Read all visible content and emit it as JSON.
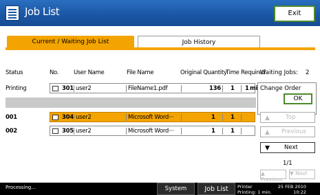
{
  "title": "Job List",
  "exit_label": "Exit",
  "tabs": [
    {
      "label": "Current / Waiting Job List"
    },
    {
      "label": "Job History"
    }
  ],
  "headers": {
    "status": "Status",
    "no": "No.",
    "user": "User Name",
    "file": "File Name",
    "qty": "Original Quantity",
    "time": "Time Required"
  },
  "rows": [
    {
      "status": "Printing",
      "no": "301",
      "user": "user2",
      "file": "FileName1.pdf",
      "orig": "136",
      "qty": "1",
      "time": "1",
      "time_unit": "min."
    },
    {
      "status": "001",
      "no": "304",
      "user": "user2",
      "file": "Microsoft Word···",
      "orig": "1",
      "qty": "1",
      "time": ""
    },
    {
      "status": "002",
      "no": "305",
      "user": "user2",
      "file": "Microsoft Word···",
      "orig": "1",
      "qty": "1",
      "time": ""
    }
  ],
  "waiting": {
    "label": "Waiting Jobs:",
    "count": "2"
  },
  "change_order": {
    "label": "Change Order",
    "ok": "OK"
  },
  "side_buttons": {
    "top": "Top",
    "previous": "Previous",
    "next": "Next"
  },
  "page": {
    "count": "1/1",
    "prev": "Previous",
    "next": "Next"
  },
  "statusbar": {
    "message": "Processing...",
    "system_status": "System Status",
    "job_list": "Job List",
    "printer_line1": "Printer",
    "printer_line2": "Printing: 1 min.",
    "date_line1": "25 FEB   2010",
    "date_line2": "10:22"
  }
}
